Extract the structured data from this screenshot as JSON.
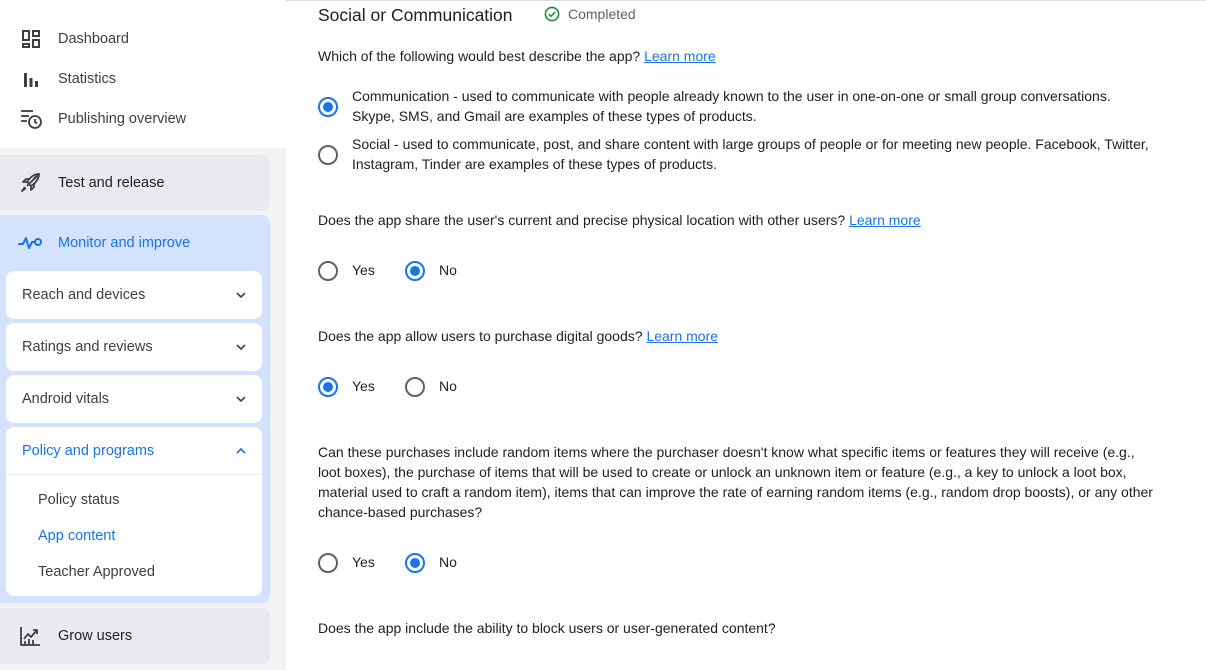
{
  "sidebar": {
    "top_items": [
      {
        "label": "Dashboard",
        "icon": "dashboard-icon"
      },
      {
        "label": "Statistics",
        "icon": "bar-chart-icon"
      },
      {
        "label": "Publishing overview",
        "icon": "schedule-list-icon"
      }
    ],
    "test_release": {
      "label": "Test and release",
      "icon": "rocket-icon"
    },
    "monitor": {
      "label": "Monitor and improve",
      "icon": "pulse-icon"
    },
    "cards": [
      {
        "label": "Reach and devices",
        "expanded": false
      },
      {
        "label": "Ratings and reviews",
        "expanded": false
      },
      {
        "label": "Android vitals",
        "expanded": false
      },
      {
        "label": "Policy and programs",
        "expanded": true
      }
    ],
    "policy_sub_items": [
      {
        "label": "Policy status",
        "active": false
      },
      {
        "label": "App content",
        "active": true
      },
      {
        "label": "Teacher Approved",
        "active": false
      }
    ],
    "grow": {
      "label": "Grow users",
      "icon": "growth-chart-icon"
    }
  },
  "main": {
    "title": "Social or Communication",
    "status": "Completed",
    "learn_more": "Learn more",
    "q1": {
      "text": "Which of the following would best describe the app?",
      "options": [
        {
          "line1": "Communication - used to communicate with people already known to the user in one-on-one or small group conversations.",
          "line2": "Skype, SMS, and Gmail are examples of these types of products.",
          "selected": true
        },
        {
          "line1": "Social - used to communicate, post, and share content with large groups of people or for meeting new people. Facebook, Twitter,",
          "line2": "Instagram, Tinder are examples of these types of products.",
          "selected": false
        }
      ]
    },
    "q2": {
      "text": "Does the app share the user's current and precise physical location with other users?",
      "yes": "Yes",
      "no": "No",
      "selected": "No"
    },
    "q3": {
      "text": "Does the app allow users to purchase digital goods?",
      "yes": "Yes",
      "no": "No",
      "selected": "Yes"
    },
    "q4": {
      "lines": [
        "Can these purchases include random items where the purchaser doesn't know what specific items or features they will receive (e.g.,",
        "loot boxes), the purchase of items that will be used to create or unlock an unknown item or feature (e.g., a key to unlock a loot box,",
        "material used to craft a random item), items that can improve the rate of earning random items (e.g., random drop boosts), or any other",
        "chance-based purchases?"
      ],
      "yes": "Yes",
      "no": "No",
      "selected": "No"
    },
    "q5": {
      "text": "Does the app include the ability to block users or user-generated content?"
    }
  },
  "colors": {
    "accent": "#1a73e8",
    "sidebar_bg": "#f1f3f4",
    "monitor_bg": "#d3e3fd",
    "completed_green": "#1e8e3e"
  }
}
